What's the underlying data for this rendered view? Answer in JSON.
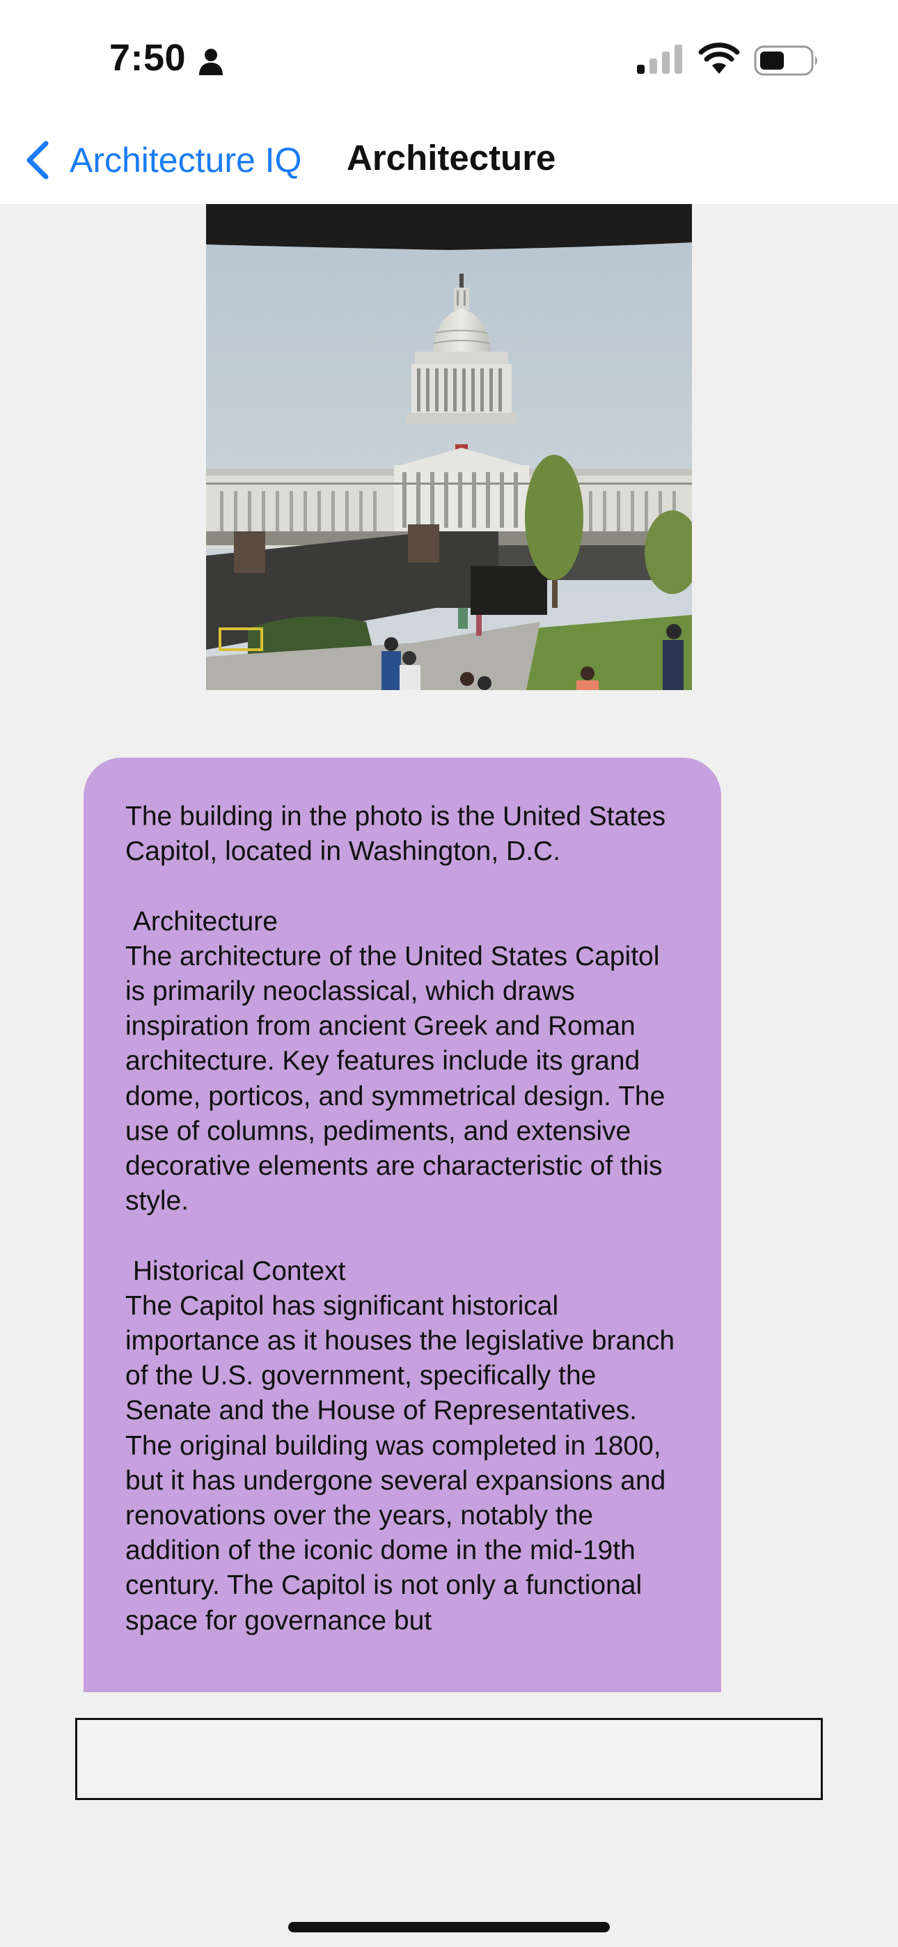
{
  "status_bar": {
    "time": "7:50",
    "icons": [
      "person-icon",
      "cellular-signal-icon",
      "wifi-icon",
      "battery-icon"
    ]
  },
  "nav": {
    "back_label": "Architecture IQ",
    "title": "Architecture"
  },
  "photo": {
    "subject": "United States Capitol building"
  },
  "response": {
    "text": "The building in the photo is the United States Capitol, located in Washington, D.C.\n\n Architecture\nThe architecture of the United States Capitol is primarily neoclassical, which draws inspiration from ancient Greek and Roman architecture. Key features include its grand dome, porticos, and symmetrical design. The use of columns, pediments, and extensive decorative elements are characteristic of this style.\n\n Historical Context\nThe Capitol has significant historical importance as it houses the legislative branch of the U.S. government, specifically the Senate and the House of Representatives. The original building was completed in 1800, but it has undergone several expansions and renovations over the years, notably the addition of the iconic dome in the mid-19th century. The Capitol is not only a functional space for governance but"
  },
  "input": {
    "value": "",
    "placeholder": ""
  },
  "colors": {
    "accent": "#1a7cf5",
    "bubble": "#c7a1dd",
    "background": "#f0f0f0"
  }
}
